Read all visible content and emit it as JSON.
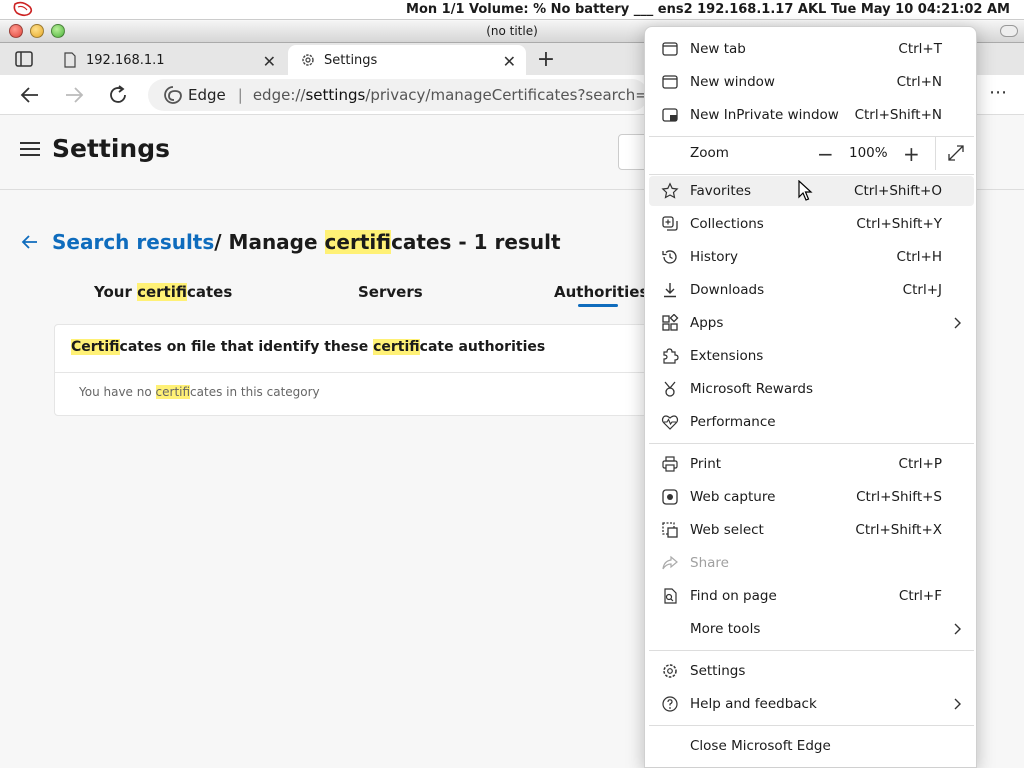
{
  "os": {
    "status": "Mon 1/1  Volume: %  No battery  ___  ens2 192.168.1.17  AKL Tue May 10 04:21:02 AM"
  },
  "window": {
    "title": "(no title)"
  },
  "tabs": [
    {
      "label": "192.168.1.1"
    },
    {
      "label": "Settings"
    }
  ],
  "address": {
    "brand": "Edge",
    "scheme": "edge://",
    "host": "settings",
    "path": "/privacy/manageCertificates?search="
  },
  "settings": {
    "title": "Settings",
    "crumb_link": "Search results",
    "crumb_sep": " / Manage ",
    "crumb_hl": "certifi",
    "crumb_tail": "cates - 1 result"
  },
  "cert_tabs": [
    {
      "pre": "Your ",
      "hl": "certifi",
      "post": "cates"
    },
    {
      "pre": "Servers",
      "hl": "",
      "post": ""
    },
    {
      "pre": "Authorities",
      "hl": "",
      "post": ""
    }
  ],
  "card": {
    "head_hl1": "Certifi",
    "head_mid": "cates on file that identify these ",
    "head_hl2": "certifi",
    "head_tail": "cate authorities",
    "empty_pre": "You have no ",
    "empty_hl": "certifi",
    "empty_post": "cates in this category"
  },
  "menu": {
    "items": [
      {
        "label": "New tab",
        "shortcut": "Ctrl+T",
        "icon": "new-tab-icon"
      },
      {
        "label": "New window",
        "shortcut": "Ctrl+N",
        "icon": "new-window-icon"
      },
      {
        "label": "New InPrivate window",
        "shortcut": "Ctrl+Shift+N",
        "icon": "inprivate-icon"
      },
      {
        "label": "Zoom",
        "shortcut": "",
        "icon": ""
      },
      {
        "label": "Favorites",
        "shortcut": "Ctrl+Shift+O",
        "icon": "star-icon"
      },
      {
        "label": "Collections",
        "shortcut": "Ctrl+Shift+Y",
        "icon": "collections-icon"
      },
      {
        "label": "History",
        "shortcut": "Ctrl+H",
        "icon": "history-icon"
      },
      {
        "label": "Downloads",
        "shortcut": "Ctrl+J",
        "icon": "download-icon"
      },
      {
        "label": "Apps",
        "shortcut": "",
        "icon": "apps-icon"
      },
      {
        "label": "Extensions",
        "shortcut": "",
        "icon": "puzzle-icon"
      },
      {
        "label": "Microsoft Rewards",
        "shortcut": "",
        "icon": "rewards-icon"
      },
      {
        "label": "Performance",
        "shortcut": "",
        "icon": "heartbeat-icon"
      },
      {
        "label": "Print",
        "shortcut": "Ctrl+P",
        "icon": "printer-icon"
      },
      {
        "label": "Web capture",
        "shortcut": "Ctrl+Shift+S",
        "icon": "web-capture-icon"
      },
      {
        "label": "Web select",
        "shortcut": "Ctrl+Shift+X",
        "icon": "web-select-icon"
      },
      {
        "label": "Share",
        "shortcut": "",
        "icon": "share-icon"
      },
      {
        "label": "Find on page",
        "shortcut": "Ctrl+F",
        "icon": "find-icon"
      },
      {
        "label": "More tools",
        "shortcut": "",
        "icon": ""
      },
      {
        "label": "Settings",
        "shortcut": "",
        "icon": "gear-icon"
      },
      {
        "label": "Help and feedback",
        "shortcut": "",
        "icon": "help-icon"
      },
      {
        "label": "Close Microsoft Edge",
        "shortcut": "",
        "icon": ""
      }
    ],
    "zoom_value": "100%",
    "zoom_minus": "−",
    "zoom_plus": "+"
  }
}
